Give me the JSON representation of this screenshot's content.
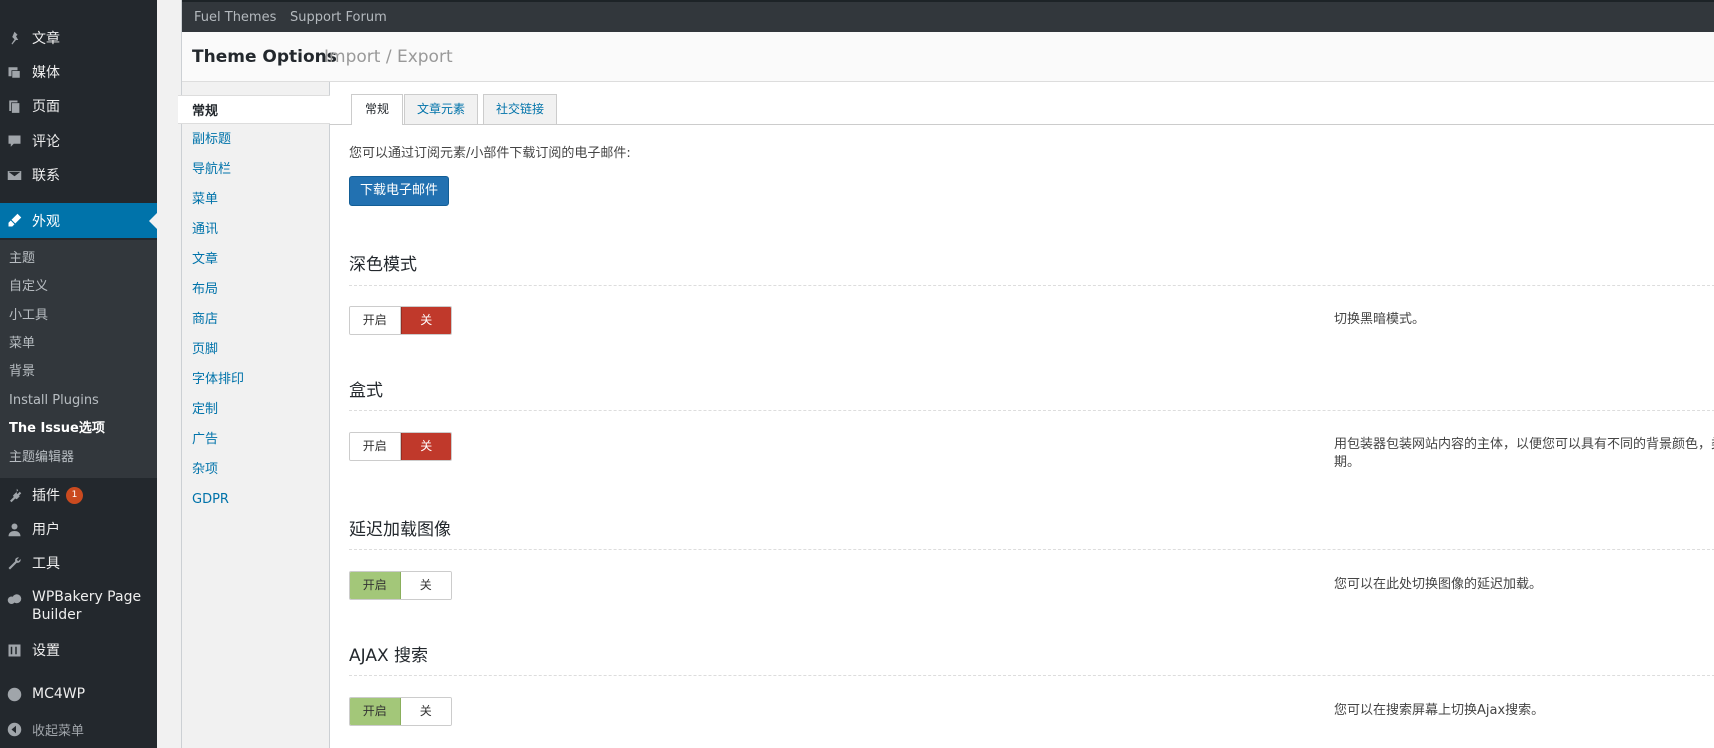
{
  "admin_menu": {
    "items": [
      {
        "label": "文章",
        "icon": "pin-icon"
      },
      {
        "label": "媒体",
        "icon": "media-icon"
      },
      {
        "label": "页面",
        "icon": "page-icon"
      },
      {
        "label": "评论",
        "icon": "comment-icon"
      },
      {
        "label": "联系",
        "icon": "mail-icon"
      },
      {
        "label": "外观",
        "icon": "brush-icon",
        "current": true
      },
      {
        "label": "插件",
        "icon": "plugin-icon",
        "badge": "1"
      },
      {
        "label": "用户",
        "icon": "user-icon"
      },
      {
        "label": "工具",
        "icon": "wrench-icon"
      },
      {
        "label": "WPBakery Page Builder",
        "icon": "cloud-icon"
      },
      {
        "label": "设置",
        "icon": "settings-icon"
      },
      {
        "label": "MC4WP",
        "icon": "mc4wp-icon"
      },
      {
        "label": "收起菜单",
        "icon": "collapse-icon"
      }
    ],
    "submenu": [
      "主题",
      "自定义",
      "小工具",
      "菜单",
      "背景",
      "Install Plugins",
      "The Issue选项",
      "主题编辑器"
    ]
  },
  "topbar": {
    "link1": "Fuel Themes",
    "link2": "Support Forum"
  },
  "header": {
    "title": "Theme Options",
    "subtitle": "Import / Export"
  },
  "sidenav": {
    "active": "常规",
    "items": [
      "副标题",
      "导航栏",
      "菜单",
      "通讯",
      "文章",
      "布局",
      "商店",
      "页脚",
      "字体排印",
      "定制",
      "广告",
      "杂项",
      "GDPR"
    ]
  },
  "tabs": [
    "常规",
    "文章元素",
    "社交链接"
  ],
  "intro": {
    "text": "您可以通过订阅元素/小部件下载订阅的电子邮件:",
    "button": "下载电子邮件"
  },
  "sections": [
    {
      "title": "深色模式",
      "on": "开启",
      "off": "关",
      "state": "off",
      "desc": "切换黑暗模式。"
    },
    {
      "title": "盒式",
      "on": "开启",
      "off": "关",
      "state": "off",
      "desc": "用包装器包装网站内容的主体，以便您可以具有不同的背景颜色，类",
      "desc2": "期。"
    },
    {
      "title": "延迟加载图像",
      "on": "开启",
      "off": "关",
      "state": "on",
      "desc": "您可以在此处切换图像的延迟加载。"
    },
    {
      "title": "AJAX 搜索",
      "on": "开启",
      "off": "关",
      "state": "on",
      "desc": "您可以在搜索屏幕上切换Ajax搜索。"
    }
  ],
  "colors": {
    "primary": "#2271b1",
    "toggle_on": "#a3c779",
    "toggle_off": "#c0392b",
    "admin_bg": "#23282d",
    "admin_current": "#0073aa"
  }
}
